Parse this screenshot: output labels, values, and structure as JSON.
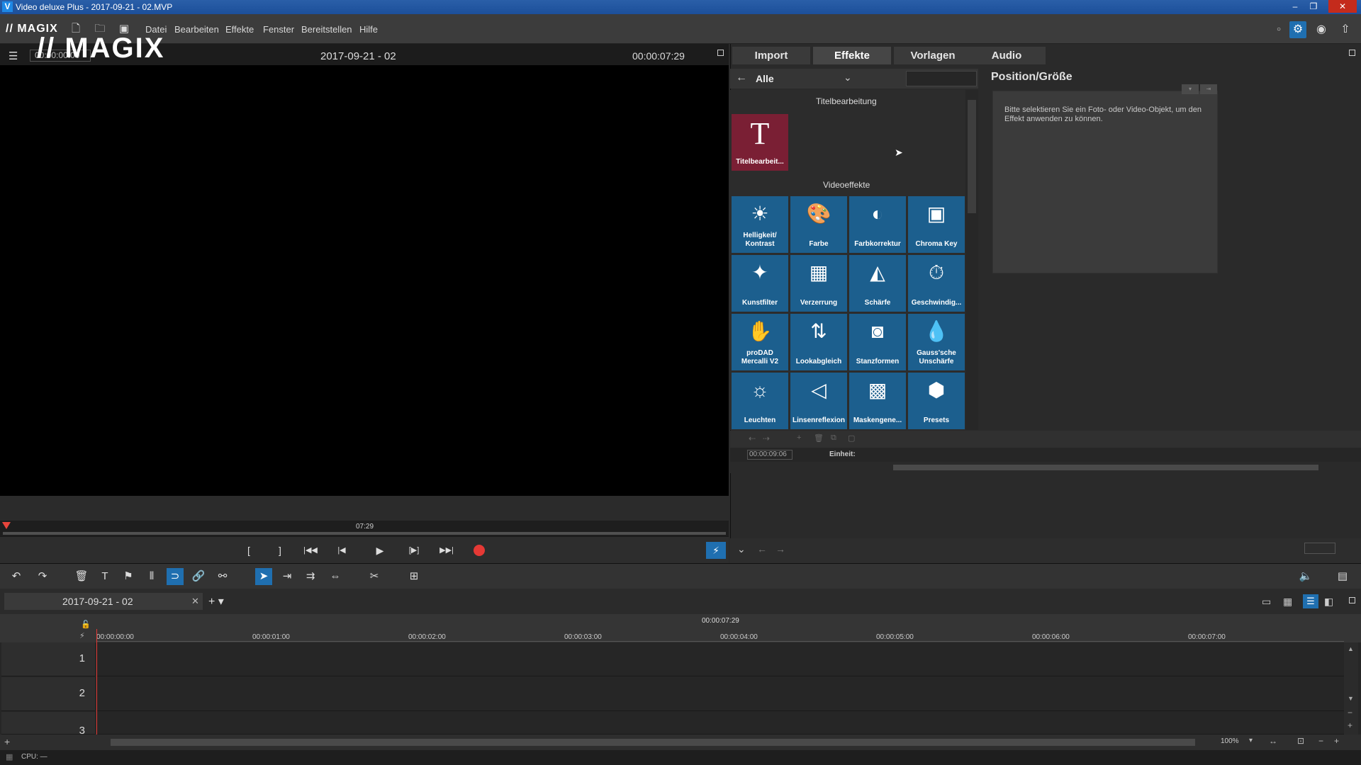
{
  "window": {
    "title": "Video deluxe Plus - 2017-09-21 - 02.MVP",
    "icon": "V",
    "controls": [
      "–",
      "❐",
      "✕"
    ]
  },
  "menubar": {
    "logo": "// MAGIX",
    "items": [
      "Datei",
      "Bearbeiten",
      "Effekte",
      "Fenster",
      "Bereitstellen",
      "Hilfe"
    ]
  },
  "preview": {
    "overlay_logo": "// MAGIX",
    "timecode": "00:00:00:00",
    "title": "2017-09-21 - 02",
    "duration": "00:00:07:29",
    "scrub_label": "07:29"
  },
  "transport": {
    "buttons": [
      "[",
      "]",
      "|◀◀",
      "|◀",
      "▶",
      "[▶]",
      "▶▶|"
    ]
  },
  "media_pool": {
    "tabs": [
      "Import",
      "Effekte",
      "Vorlagen",
      "Audio"
    ],
    "active_tab": "Effekte",
    "category": "Alle",
    "sections": {
      "title_edit": "Titelbearbeitung",
      "video_effects": "Videoeffekte"
    },
    "title_tile": {
      "icon": "T",
      "label": "Titelbearbeit..."
    },
    "tiles": [
      {
        "icon": "☀",
        "label": "Helligkeit/ Kontrast"
      },
      {
        "icon": "🎨",
        "label": "Farbe"
      },
      {
        "icon": "◐",
        "label": "Farbkorrektur"
      },
      {
        "icon": "▣",
        "label": "Chroma Key"
      },
      {
        "icon": "✦",
        "label": "Kunstfilter"
      },
      {
        "icon": "▦",
        "label": "Verzerrung"
      },
      {
        "icon": "◭",
        "label": "Schärfe"
      },
      {
        "icon": "⏱",
        "label": "Geschwindig..."
      },
      {
        "icon": "✋",
        "label": "proDAD Mercalli V2"
      },
      {
        "icon": "⇅",
        "label": "Lookabgleich"
      },
      {
        "icon": "◙",
        "label": "Stanzformen"
      },
      {
        "icon": "💧",
        "label": "Gauss'sche Unschärfe"
      },
      {
        "icon": "☼",
        "label": "Leuchten"
      },
      {
        "icon": "◁",
        "label": "Linsenreflexion"
      },
      {
        "icon": "▩",
        "label": "Maskengene..."
      },
      {
        "icon": "⬢",
        "label": "Presets"
      }
    ]
  },
  "effect_panel": {
    "title": "Position/Größe",
    "message": "Bitte selektieren Sie ein Foto- oder Video-Objekt, um den Effekt anwenden zu können.",
    "keyframe_timecode": "00:00:09:06",
    "unit_label": "Einheit:"
  },
  "timeline": {
    "project_tab": "2017-09-21 - 02",
    "close_glyph": "✕",
    "add_glyph": "+ ▾",
    "duration": "00:00:07:29",
    "ruler": [
      "00:00:00:00",
      "00:00:01:00",
      "00:00:02:00",
      "00:00:03:00",
      "00:00:04:00",
      "00:00:05:00",
      "00:00:06:00",
      "00:00:07:00"
    ],
    "tracks": [
      "1",
      "2",
      "3"
    ],
    "zoom": "100%"
  },
  "status": {
    "cpu": "CPU: —"
  }
}
